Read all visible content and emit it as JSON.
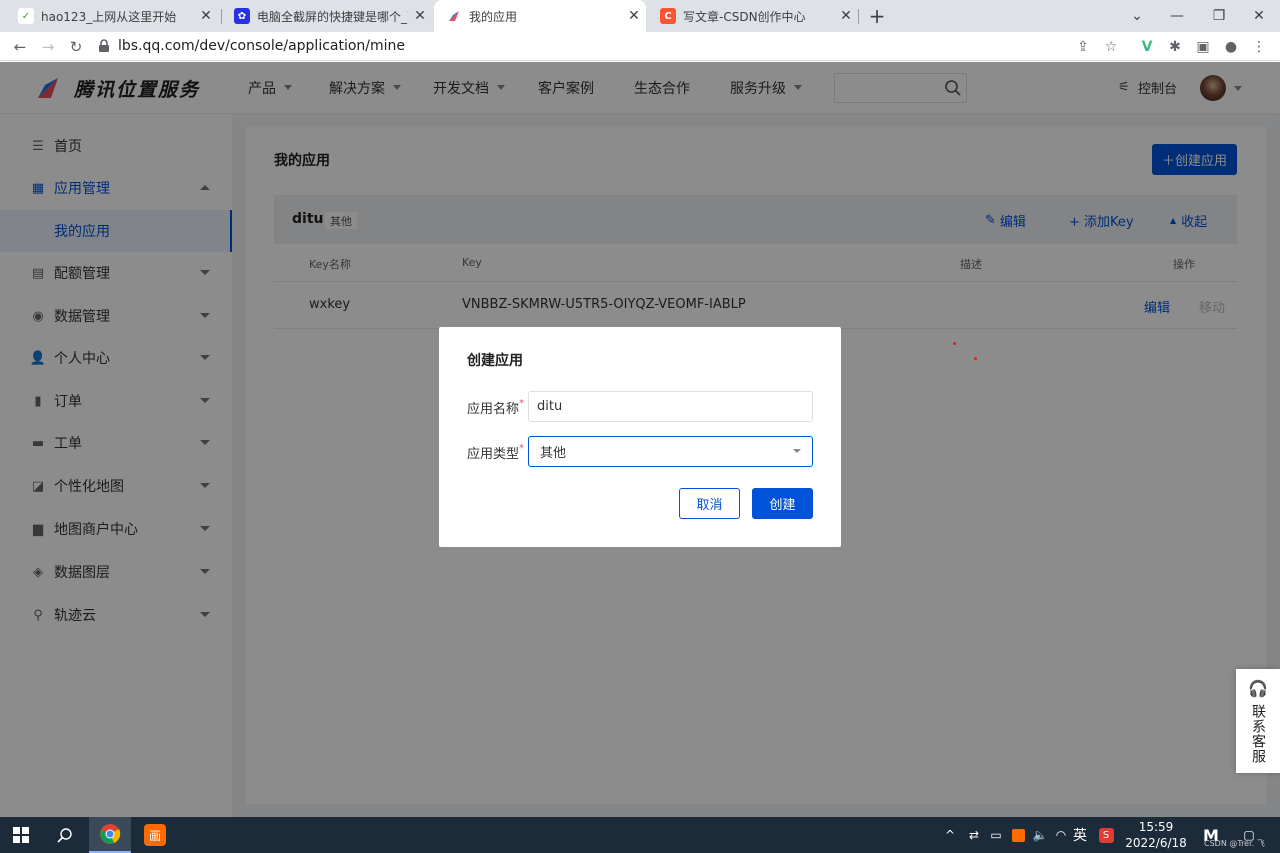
{
  "browser": {
    "tabs": [
      {
        "title": "hao123_上网从这里开始"
      },
      {
        "title": "电脑全截屏的快捷键是哪个_百度"
      },
      {
        "title": "我的应用"
      },
      {
        "title": "写文章-CSDN创作中心"
      }
    ],
    "url": "lbs.qq.com/dev/console/application/mine"
  },
  "site": {
    "brand": "腾讯位置服务",
    "nav": [
      "产品",
      "解决方案",
      "开发文档",
      "客户案例",
      "生态合作",
      "服务升级"
    ],
    "console": "控制台"
  },
  "sidebar": {
    "items": [
      {
        "label": "首页",
        "icon": "list-icon"
      },
      {
        "label": "应用管理",
        "icon": "grid-icon"
      },
      {
        "label": "我的应用"
      },
      {
        "label": "配额管理",
        "icon": "chart-icon"
      },
      {
        "label": "数据管理",
        "icon": "database-icon"
      },
      {
        "label": "个人中心",
        "icon": "user-icon"
      },
      {
        "label": "订单",
        "icon": "clipboard-icon"
      },
      {
        "label": "工单",
        "icon": "ticket-icon"
      },
      {
        "label": "个性化地图",
        "icon": "map-icon"
      },
      {
        "label": "地图商户中心",
        "icon": "shop-icon"
      },
      {
        "label": "数据图层",
        "icon": "layers-icon"
      },
      {
        "label": "轨迹云",
        "icon": "location-icon"
      }
    ]
  },
  "main": {
    "title": "我的应用",
    "create_btn": "＋创建应用",
    "app": {
      "name": "ditu",
      "type": "其他",
      "edit": "编辑",
      "add_key": "+ 添加Key",
      "collapse": "收起"
    },
    "table": {
      "headers": [
        "Key名称",
        "Key",
        "描述",
        "操作"
      ],
      "rows": [
        {
          "name": "wxkey",
          "key": "VNBBZ-SKMRW-U5TR5-OIYQZ-VEOMF-IABLP",
          "desc": "",
          "edit": "编辑",
          "move": "移动"
        }
      ]
    }
  },
  "dialog": {
    "title": "创建应用",
    "name_label": "应用名称",
    "name_value": "ditu",
    "type_label": "应用类型",
    "type_value": "其他",
    "cancel": "取消",
    "create": "创建"
  },
  "support": {
    "label": "联系客服"
  },
  "taskbar": {
    "time": "15:59",
    "date": "2022/6/18",
    "ime": "英",
    "watermark": "CSDN @Trer. 飞"
  },
  "colors": {
    "accent": "#0052d9",
    "required": "#e34d59"
  }
}
